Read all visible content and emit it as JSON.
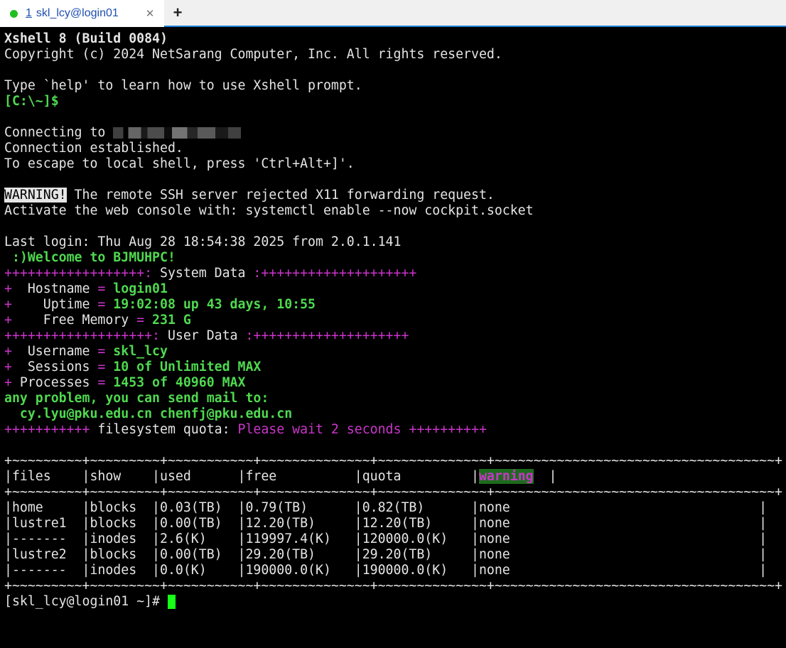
{
  "tab": {
    "number": "1",
    "title": "skl_lcy@login01",
    "close_glyph": "✕",
    "new_tab_glyph": "+",
    "status_color": "#21c021"
  },
  "header": {
    "line1": "Xshell 8 (Build 0084)",
    "line2": "Copyright (c) 2024 NetSarang Computer, Inc. All rights reserved.",
    "line3": "Type `help' to learn how to use Xshell prompt.",
    "local_prompt": "[C:\\~]$"
  },
  "connect": {
    "connecting_prefix": "Connecting to ",
    "established": "Connection established.",
    "escape": "To escape to local shell, press 'Ctrl+Alt+]'."
  },
  "warning": {
    "label": "WARNING!",
    "text": " The remote SSH server rejected X11 forwarding request.",
    "activate": "Activate the web console with: systemctl enable --now cockpit.socket"
  },
  "login": {
    "last_login": "Last login: Thu Aug 28 18:54:38 2025 from 2.0.1.141",
    "welcome": " :)Welcome to BJMUHPC!"
  },
  "system": {
    "banner_left": "++++++++++++++++++:",
    "banner_title": " System Data ",
    "banner_right": ":++++++++++++++++++++",
    "rows": [
      {
        "plus": "+",
        "label": "  Hostname ",
        "eq": "=",
        "value": " login01"
      },
      {
        "plus": "+",
        "label": "    Uptime ",
        "eq": "=",
        "value": " 19:02:08 up 43 days, 10:55"
      },
      {
        "plus": "+",
        "label": "    Free Memory ",
        "eq": "=",
        "value": " 231 G"
      }
    ]
  },
  "user": {
    "banner_left": "+++++++++++++++++++:",
    "banner_title": " User Data ",
    "banner_right": ":++++++++++++++++++++",
    "rows": [
      {
        "plus": "+",
        "label": "  Username ",
        "eq": "=",
        "value": " skl_lcy"
      },
      {
        "plus": "+",
        "label": "  Sessions ",
        "eq": "=",
        "value": " 10 of Unlimited MAX"
      },
      {
        "plus": "+",
        "label": " Processes ",
        "eq": "=",
        "value": " 1453 of 40960 MAX"
      }
    ],
    "mail_text": "any problem, you can send mail to:",
    "mail_addresses": "  cy.lyu@pku.edu.cn chenfj@pku.edu.cn"
  },
  "quota": {
    "pre": "+++++++++++",
    "label": " filesystem quota: ",
    "wait": "Please wait 2 seconds",
    "post": " ++++++++++"
  },
  "table": {
    "border": "+~~~~~~~~~+~~~~~~~~~+~~~~~~~~~~~+~~~~~~~~~~~~~~+~~~~~~~~~~~~~~+~~~~~~~~~~~~~~~~~~~~~~~~~~~~~~~~~~~~+",
    "header_pre": "|files    |show    |used      |free          |quota         |",
    "header_warn": "warning",
    "header_post": "  |",
    "rows": [
      "|home     |blocks  |0.03(TB)  |0.79(TB)      |0.82(TB)      |none                                |",
      "|lustre1  |blocks  |0.00(TB)  |12.20(TB)     |12.20(TB)     |none                                |",
      "|-------  |inodes  |2.6(K)    |119997.4(K)   |120000.0(K)   |none                                |",
      "|lustre2  |blocks  |0.00(TB)  |29.20(TB)     |29.20(TB)     |none                                |",
      "|-------  |inodes  |0.0(K)    |190000.0(K)   |190000.0(K)   |none                                |"
    ]
  },
  "prompt": "[skl_lcy@login01 ~]# ",
  "colors": {
    "background": "#000000",
    "green": "#4fd94f",
    "magenta": "#cc35cc",
    "text": "#e5e5e5",
    "cursor": "#18ff18",
    "tab_accent": "#1e7fd6"
  }
}
